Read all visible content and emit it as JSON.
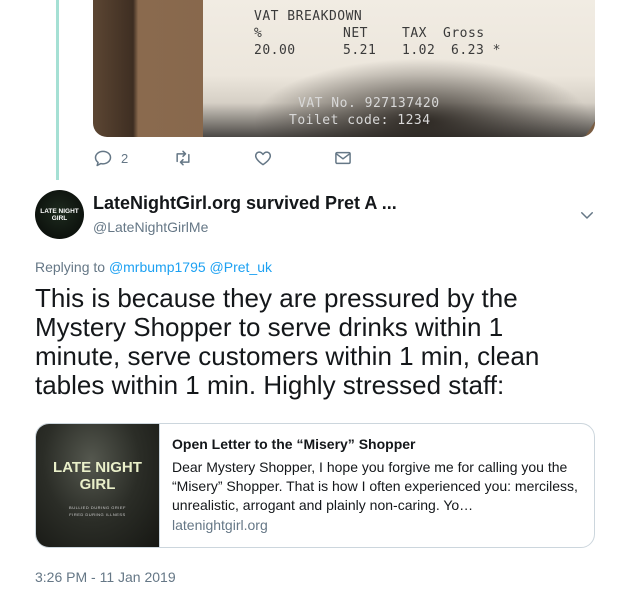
{
  "receipt": {
    "heading": "VAT BREAKDOWN",
    "col_pct": "%",
    "col_net": "NET",
    "col_tax": "TAX",
    "col_gross": "Gross",
    "row_pct": "20.00",
    "row_net": "5.21",
    "row_tax": "1.02",
    "row_gross": "6.23 *",
    "vat_no": "VAT No. 927137420",
    "toilet_code": "Toilet code: 1234"
  },
  "previous_actions": {
    "reply_count": "2"
  },
  "tweet": {
    "display_name": "LateNightGirl.org survived Pret A ...",
    "handle": "@LateNightGirlMe",
    "avatar_text_1": "LATE NIGHT GIRL",
    "replying_prefix": "Replying to",
    "mention_1": "@mrbump1795",
    "mention_2": "@Pret_uk",
    "text": "This is because they are pressured by the Mystery Shopper to serve drinks within 1 minute, serve customers within 1 min, clean tables within 1 min. Highly stressed staff:",
    "timestamp": "3:26 PM - 11 Jan 2019"
  },
  "card": {
    "image_title": "LATE NIGHT GIRL",
    "image_sub_1": "BULLIED DURING GRIEF",
    "image_sub_2": "FIRED DURING ILLNESS",
    "title": "Open Letter to the “Misery” Shopper",
    "description": "  Dear Mystery Shopper, I hope you forgive me for calling you the “Misery” Shopper. That is how I often experienced you: merciless, unrealistic, arrogant and plainly non-caring. Yo…",
    "domain": "latenightgirl.org"
  },
  "colors": {
    "link": "#1da1f2",
    "secondary_text": "#657786",
    "thread_line": "#a5e0d4",
    "border": "#ccd6dd"
  }
}
